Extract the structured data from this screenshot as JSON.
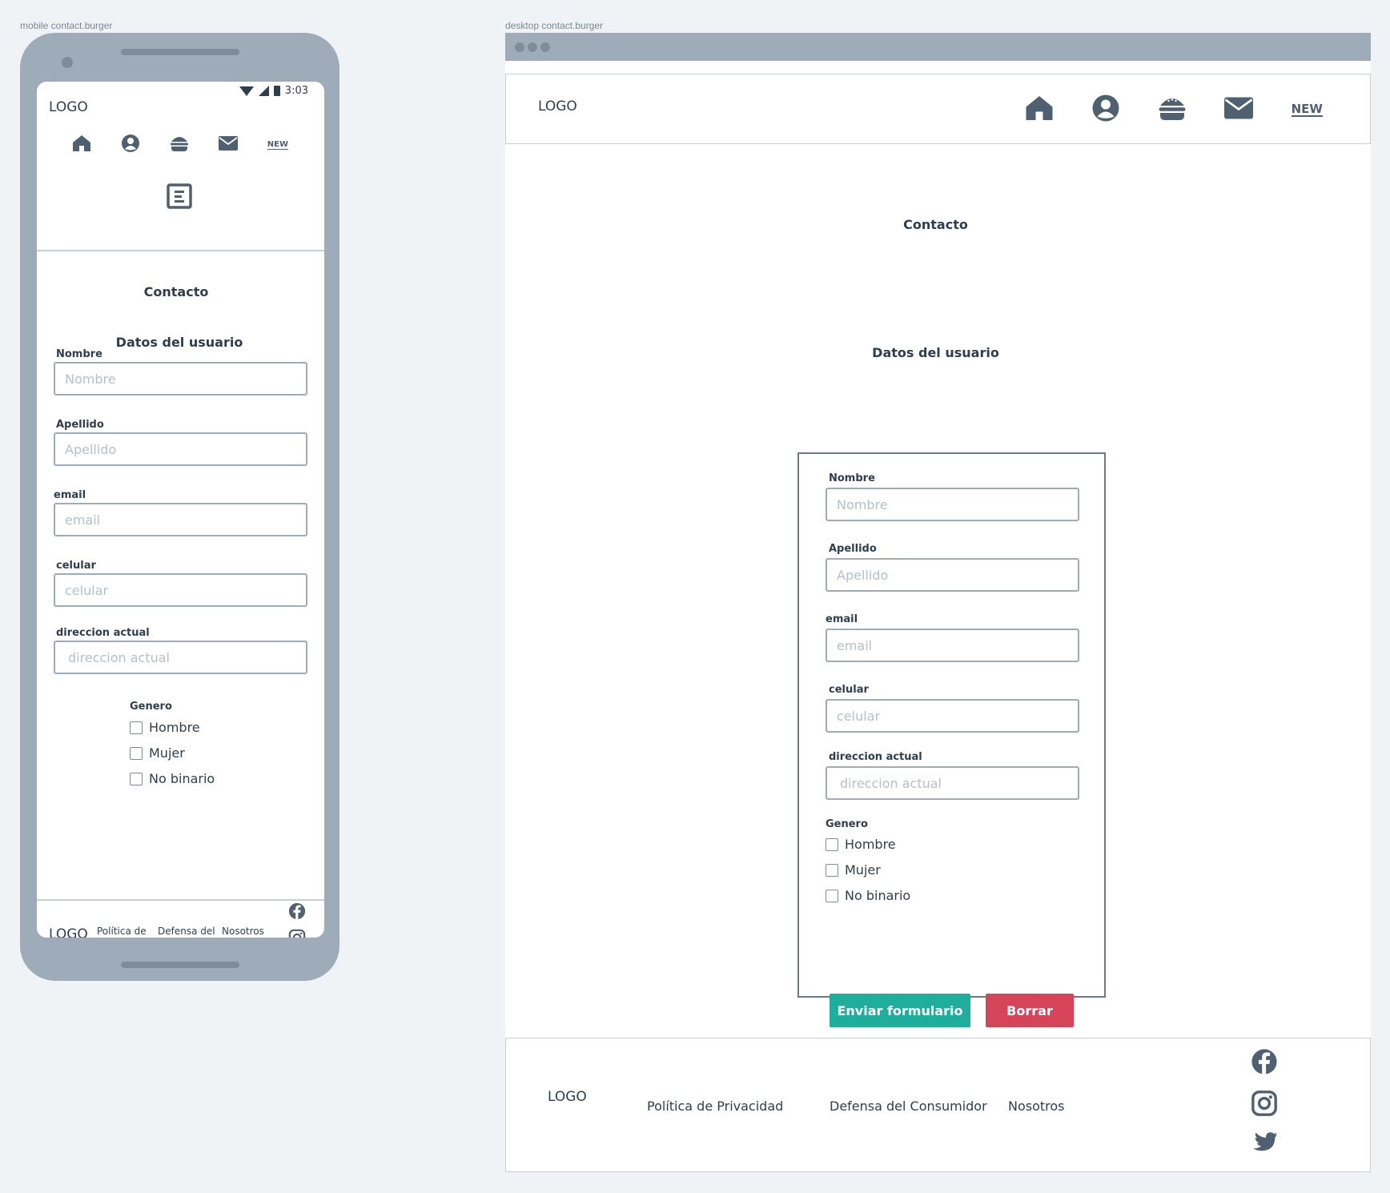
{
  "labels": {
    "mobile": "mobile contact.burger",
    "desktop": "desktop contact.burger"
  },
  "mobile": {
    "status": {
      "time": "3:03"
    },
    "logo": "LOGO",
    "nav": [
      {
        "icon": "home-icon",
        "label": "Inicio"
      },
      {
        "icon": "user-icon",
        "label": "Perfil"
      },
      {
        "icon": "burger-icon",
        "label": "Menu"
      },
      {
        "icon": "mail-icon",
        "label": "Contacto"
      },
      {
        "icon": "new-icon",
        "label": "NEW"
      }
    ],
    "menu_icon": "menu-icon",
    "title": "Contacto",
    "subtitle": "Datos del usuario",
    "fields": [
      {
        "label": "Nombre",
        "placeholder": "Nombre"
      },
      {
        "label": "Apellido",
        "placeholder": "Apellido"
      },
      {
        "label": "email",
        "placeholder": "email"
      },
      {
        "label": "celular",
        "placeholder": "celular"
      },
      {
        "label": "direccion actual",
        "placeholder": "direccion actual"
      }
    ],
    "genero": {
      "label": "Genero",
      "options": [
        "Hombre",
        "Mujer",
        "No binario"
      ]
    },
    "footer": {
      "logo": "LOGO",
      "links": [
        "Política de Privacidad",
        "Defensa del Consumidor",
        "Nosotros"
      ],
      "social": [
        "facebook-icon",
        "instagram-icon",
        "twitter-icon"
      ]
    }
  },
  "desktop": {
    "logo": "LOGO",
    "nav_new": "NEW",
    "title": "Contacto",
    "subtitle": "Datos del usuario",
    "fields": [
      {
        "label": "Nombre",
        "placeholder": "Nombre"
      },
      {
        "label": "Apellido",
        "placeholder": "Apellido"
      },
      {
        "label": "email",
        "placeholder": "email"
      },
      {
        "label": "celular",
        "placeholder": "celular"
      },
      {
        "label": "direccion actual",
        "placeholder": "direccion actual"
      }
    ],
    "genero": {
      "label": "Genero",
      "options": [
        "Hombre",
        "Mujer",
        "No binario"
      ]
    },
    "buttons": {
      "send": "Enviar formulario",
      "clear": "Borrar"
    },
    "footer": {
      "logo": "LOGO",
      "links": [
        "Política de Privacidad",
        "Defensa del Consumidor",
        "Nosotros"
      ]
    }
  },
  "colors": {
    "primary": "#4f6070",
    "accent_send": "#1fad9c",
    "accent_clear": "#d64459",
    "frame": "#9eacb9"
  }
}
